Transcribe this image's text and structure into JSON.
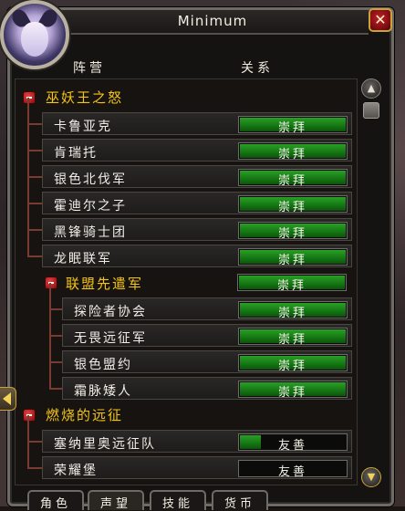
{
  "window": {
    "title": "Minimum",
    "close_glyph": "✕"
  },
  "columns": {
    "faction": "阵营",
    "standing": "关系"
  },
  "rows": [
    {
      "type": "group",
      "name": "巫妖王之怒"
    },
    {
      "type": "faction",
      "name": "卡鲁亚克",
      "standing": "崇拜",
      "fill": 1.0
    },
    {
      "type": "faction",
      "name": "肯瑞托",
      "standing": "崇拜",
      "fill": 1.0
    },
    {
      "type": "faction",
      "name": "银色北伐军",
      "standing": "崇拜",
      "fill": 1.0
    },
    {
      "type": "faction",
      "name": "霍迪尔之子",
      "standing": "崇拜",
      "fill": 1.0
    },
    {
      "type": "faction",
      "name": "黑锋骑士团",
      "standing": "崇拜",
      "fill": 1.0
    },
    {
      "type": "faction",
      "name": "龙眠联军",
      "standing": "崇拜",
      "fill": 1.0
    },
    {
      "type": "subgroup",
      "name": "联盟先遣军",
      "standing": "崇拜",
      "fill": 1.0
    },
    {
      "type": "subfaction",
      "name": "探险者协会",
      "standing": "崇拜",
      "fill": 1.0
    },
    {
      "type": "subfaction",
      "name": "无畏远征军",
      "standing": "崇拜",
      "fill": 1.0
    },
    {
      "type": "subfaction",
      "name": "银色盟约",
      "standing": "崇拜",
      "fill": 1.0
    },
    {
      "type": "subfaction",
      "name": "霜脉矮人",
      "standing": "崇拜",
      "fill": 1.0
    },
    {
      "type": "group",
      "name": "燃烧的远征"
    },
    {
      "type": "faction",
      "name": "塞纳里奥远征队",
      "standing": "友善",
      "fill": 0.2
    },
    {
      "type": "faction",
      "name": "荣耀堡",
      "standing": "友善",
      "fill": 0.0
    }
  ],
  "tabs": [
    "角色",
    "声望",
    "技能",
    "货币"
  ],
  "icons": {
    "collapse": "minus-icon",
    "scroll_up": "arrow-up-icon",
    "scroll_down": "arrow-down-icon",
    "side": "arrow-left-icon",
    "close": "close-icon"
  },
  "colors": {
    "group_header": "#f4c417",
    "bar_fill": "#1f8e1c",
    "frame_border": "#6e6a66"
  }
}
